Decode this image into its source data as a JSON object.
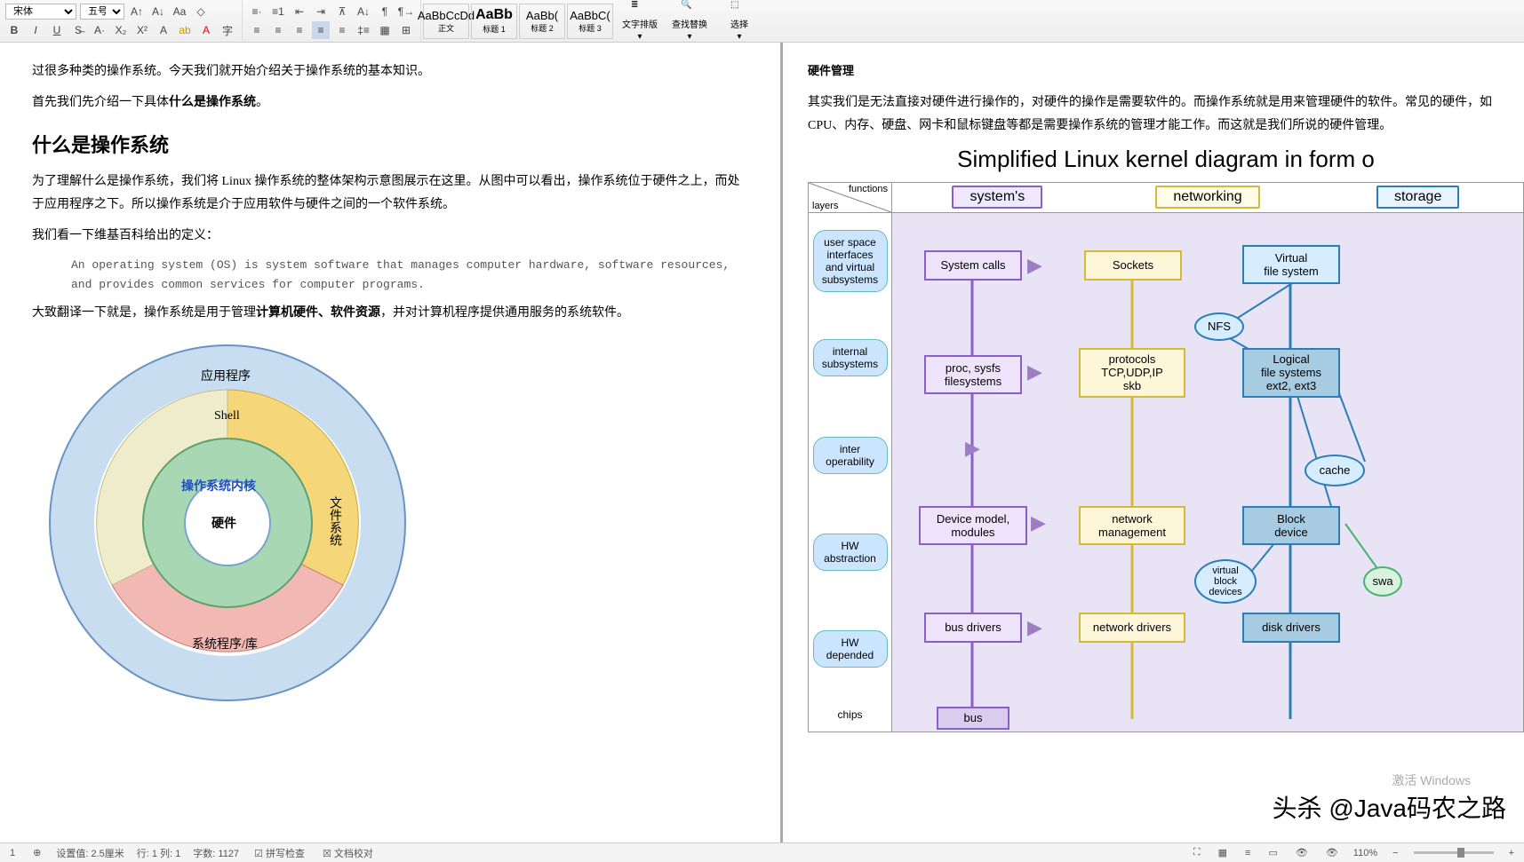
{
  "toolbar": {
    "font": "宋体",
    "size": "五号",
    "styles": [
      {
        "preview": "AaBbCcDd",
        "label": "正文"
      },
      {
        "preview": "AaBb",
        "label": "标题 1"
      },
      {
        "preview": "AaBb(",
        "label": "标题 2"
      },
      {
        "preview": "AaBbC(",
        "label": "标题 3"
      }
    ],
    "layout_label": "文字排版",
    "find_label": "查找替换",
    "select_label": "选择"
  },
  "left": {
    "line1": "过很多种类的操作系统。今天我们就开始介绍关于操作系统的基本知识。",
    "line2_a": "首先我们先介绍一下具体",
    "line2_b": "什么是操作系统",
    "line2_c": "。",
    "h2": "什么是操作系统",
    "p1": "为了理解什么是操作系统，我们将 Linux 操作系统的整体架构示意图展示在这里。从图中可以看出，操作系统位于硬件之上，而处于应用程序之下。所以操作系统是介于应用软件与硬件之间的一个软件系统。",
    "p2": "我们看一下维基百科给出的定义：",
    "quote": "An operating system (OS) is system software that manages computer hardware, software resources, and provides common services for computer programs.",
    "p3_a": "大致翻译一下就是，操作系统是用于管理",
    "p3_b": "计算机硬件、软件资源",
    "p3_c": "，并对计算机程序提供通用服务的系统软件。",
    "ring": {
      "apps": "应用程序",
      "shell": "Shell",
      "kernel": "操作系统内核",
      "hardware": "硬件",
      "fs": "文件系统",
      "syslib": "系统程序/库"
    }
  },
  "right": {
    "header": "硬件管理",
    "p1": "其实我们是无法直接对硬件进行操作的，对硬件的操作是需要软件的。而操作系统就是用来管理硬件的软件。常见的硬件，如 CPU、内存、硬盘、网卡和鼠标键盘等都是需要操作系统的管理才能工作。而这就是我们所说的硬件管理。",
    "title": "Simplified Linux kernel diagram in form o",
    "corner_top": "functions",
    "corner_bot": "layers",
    "cols": [
      {
        "label": "system's",
        "border": "#8a5fc9",
        "bg": "#f0e8ff"
      },
      {
        "label": "networking",
        "border": "#d4b93a",
        "bg": "#fffce8"
      },
      {
        "label": "storage",
        "border": "#2a7db8",
        "bg": "#e8f4ff"
      }
    ],
    "rows": [
      "user space\ninterfaces\nand virtual\nsubsystems",
      "internal\nsubsystems",
      "inter\noperability",
      "HW\nabstraction",
      "HW\ndepended",
      "chips"
    ],
    "nodes": {
      "syscalls": "System calls",
      "sockets": "Sockets",
      "vfs": "Virtual\nfile system",
      "nfs": "NFS",
      "proc": "proc, sysfs\nfilesystems",
      "protocols": "protocols\nTCP,UDP,IP\nskb",
      "logfs": "Logical\nfile systems\next2, ext3",
      "cache": "cache",
      "devmodel": "Device model,\nmodules",
      "netmgmt": "network\nmanagement",
      "blockdev": "Block\ndevice",
      "vbd": "virtual\nblock\ndevices",
      "swa": "swa",
      "busdrv": "bus drivers",
      "netdrv": "network drivers",
      "diskdrv": "disk drivers",
      "bus": "bus"
    }
  },
  "status": {
    "page": "1",
    "set_val": "设置值: 2.5厘米",
    "row_col": "行: 1  列: 1",
    "words": "字数: 1127",
    "spell": "拼写检查",
    "proof": "文档校对",
    "zoom": "110%"
  },
  "watermark": {
    "line1": "激活 Windows"
  },
  "overlay": "头杀 @Java码农之路"
}
